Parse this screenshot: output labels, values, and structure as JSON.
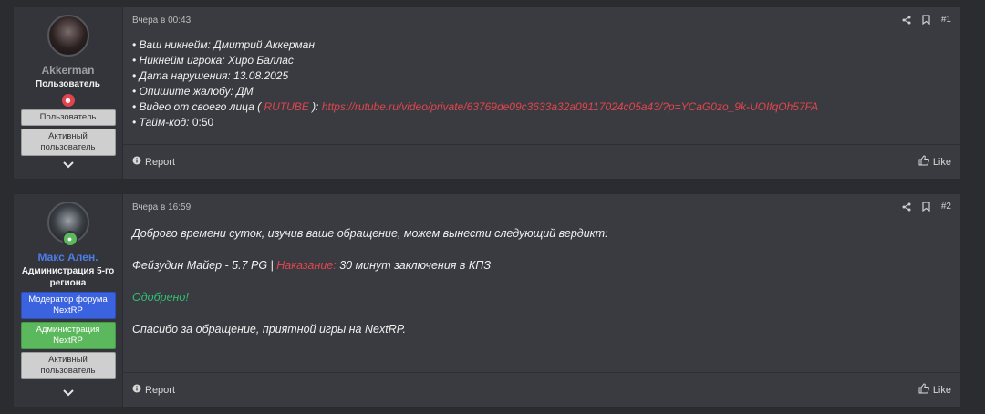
{
  "posts": [
    {
      "user": {
        "name": "Akkerman",
        "title": "Пользователь",
        "banners": [
          "Пользователь",
          "Активный пользователь"
        ]
      },
      "time": "Вчера в 00:43",
      "number": "#1",
      "lines": [
        {
          "label": "• Ваш никнейм:",
          "value": " Дмитрий Аккерман"
        },
        {
          "label": "• Никнейм игрока:",
          "value": " Хиро Баллас"
        },
        {
          "label": "• Дата нарушения:",
          "value": " 13.08.2025"
        },
        {
          "label": "• Опишите жалобу:",
          "value": " ДМ"
        }
      ],
      "video": {
        "label_start": "• Видео от своего лица (",
        "brand": " RUTUBE ",
        "label_end": "):",
        "url": " https://rutube.ru/video/private/63769de09c3633a32a09117024c05a43/?p=YCaG0zo_9k-UOIfqOh57FA"
      },
      "timecode": {
        "label": "• Тайм-код:",
        "value": " 0:50"
      },
      "report": "Report",
      "like": "Like"
    },
    {
      "user": {
        "name": "Макс Ален.",
        "title": "Администрация 5-го региона",
        "banners": [
          "Модератор форума NextRP",
          "Администрация NextRP",
          "Активный пользователь"
        ]
      },
      "time": "Вчера в 16:59",
      "number": "#2",
      "intro": "Доброго времени суток, изучив ваше обращение, можем вынести следующий вердикт:",
      "verdict": {
        "subject": "Фейзудин Майер - 5.7 PG | ",
        "label": "Наказание:",
        "value": " 30 минут заключения в КПЗ"
      },
      "status": "Одобрено!",
      "closing": "Спасибо за обращение, приятной игры на NextRP.",
      "report": "Report",
      "like": "Like"
    }
  ],
  "colors": {
    "accent_red": "#e0454f",
    "accent_green": "#2fbf71",
    "name_blue": "#4e7de8",
    "banner_blue": "#3b63e0",
    "banner_green": "#5cb85c"
  }
}
